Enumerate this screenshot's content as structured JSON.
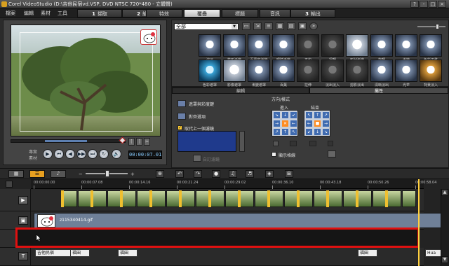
{
  "app": {
    "title": "Corel VideoStudio (D:\\吉他民宿vd.VSP, DVD NTSC 720*480 - 立體聲)",
    "window_buttons": [
      "?",
      "-",
      "□",
      "×"
    ]
  },
  "menu": [
    "檔案",
    "編輯",
    "素材",
    "工具"
  ],
  "steps": [
    {
      "num": "1",
      "label": "擷取"
    },
    {
      "num": "2",
      "label": "編輯"
    },
    {
      "num": "",
      "label": "特效"
    },
    {
      "num": "",
      "label": "覆疊",
      "active": true
    },
    {
      "num": "",
      "label": "標題"
    },
    {
      "num": "",
      "label": "音訊"
    },
    {
      "num": "3",
      "label": "輸出"
    }
  ],
  "preview": {
    "timecode": "00:00:07.01",
    "left_labels": [
      "專案",
      "素材"
    ],
    "controls": [
      "▶",
      "⏮",
      "◀",
      "▶▶",
      "⏭",
      "↻",
      "🔊"
    ],
    "mark_buttons": [
      "[",
      "]",
      "✂"
    ]
  },
  "library": {
    "category": "全部",
    "items": [
      {
        "label": "溶淡",
        "style": ""
      },
      {
        "label": "箭形漸變",
        "style": ""
      },
      {
        "label": "百葉窗漸變",
        "style": ""
      },
      {
        "label": "眼睛漸變",
        "style": ""
      },
      {
        "label": "平均",
        "style": "dark"
      },
      {
        "label": "扭轉",
        "style": "dark"
      },
      {
        "label": "形狀漸變",
        "style": "sel"
      },
      {
        "label": "旋轉",
        "style": ""
      },
      {
        "label": "漸變",
        "style": ""
      },
      {
        "label": "色彩平移",
        "style": ""
      },
      {
        "label": "色彩遮罩",
        "style": "blue"
      },
      {
        "label": "影像遮罩",
        "style": "sel"
      },
      {
        "label": "漸變遮罩",
        "style": ""
      },
      {
        "label": "百葉",
        "style": ""
      },
      {
        "label": "拉伸",
        "style": "dark"
      },
      {
        "label": "淡出淡入",
        "style": "dark"
      },
      {
        "label": "剪影淡出",
        "style": "dark"
      },
      {
        "label": "清晰淡出",
        "style": ""
      },
      {
        "label": "光芒",
        "style": ""
      },
      {
        "label": "背景淡入",
        "style": "gold"
      }
    ]
  },
  "options": {
    "tabs": [
      "編輯",
      "屬性"
    ],
    "mask": "遮罩與彩度鍵",
    "align": "對齊選項",
    "apply_prev": "取代上一個濾鏡",
    "custom_filter": "自訂濾鏡",
    "direction_style": "方向/樣式",
    "enter": "進入",
    "exit": "結束",
    "show_grid": "顯示格線"
  },
  "timeline": {
    "ruler_labels": [
      "00:00:00.00",
      "00:00:07.08",
      "00:00:14.16",
      "00:00:21.24",
      "00:00:29.02",
      "00:00:36.10",
      "00:00:43.18",
      "00:00:50.26",
      "00:00:58.04"
    ],
    "overlay_clip_name": "z115340414.gif",
    "title_clips": [
      "吉他民宿",
      "福田",
      "福田",
      "福田",
      "Hua"
    ]
  }
}
